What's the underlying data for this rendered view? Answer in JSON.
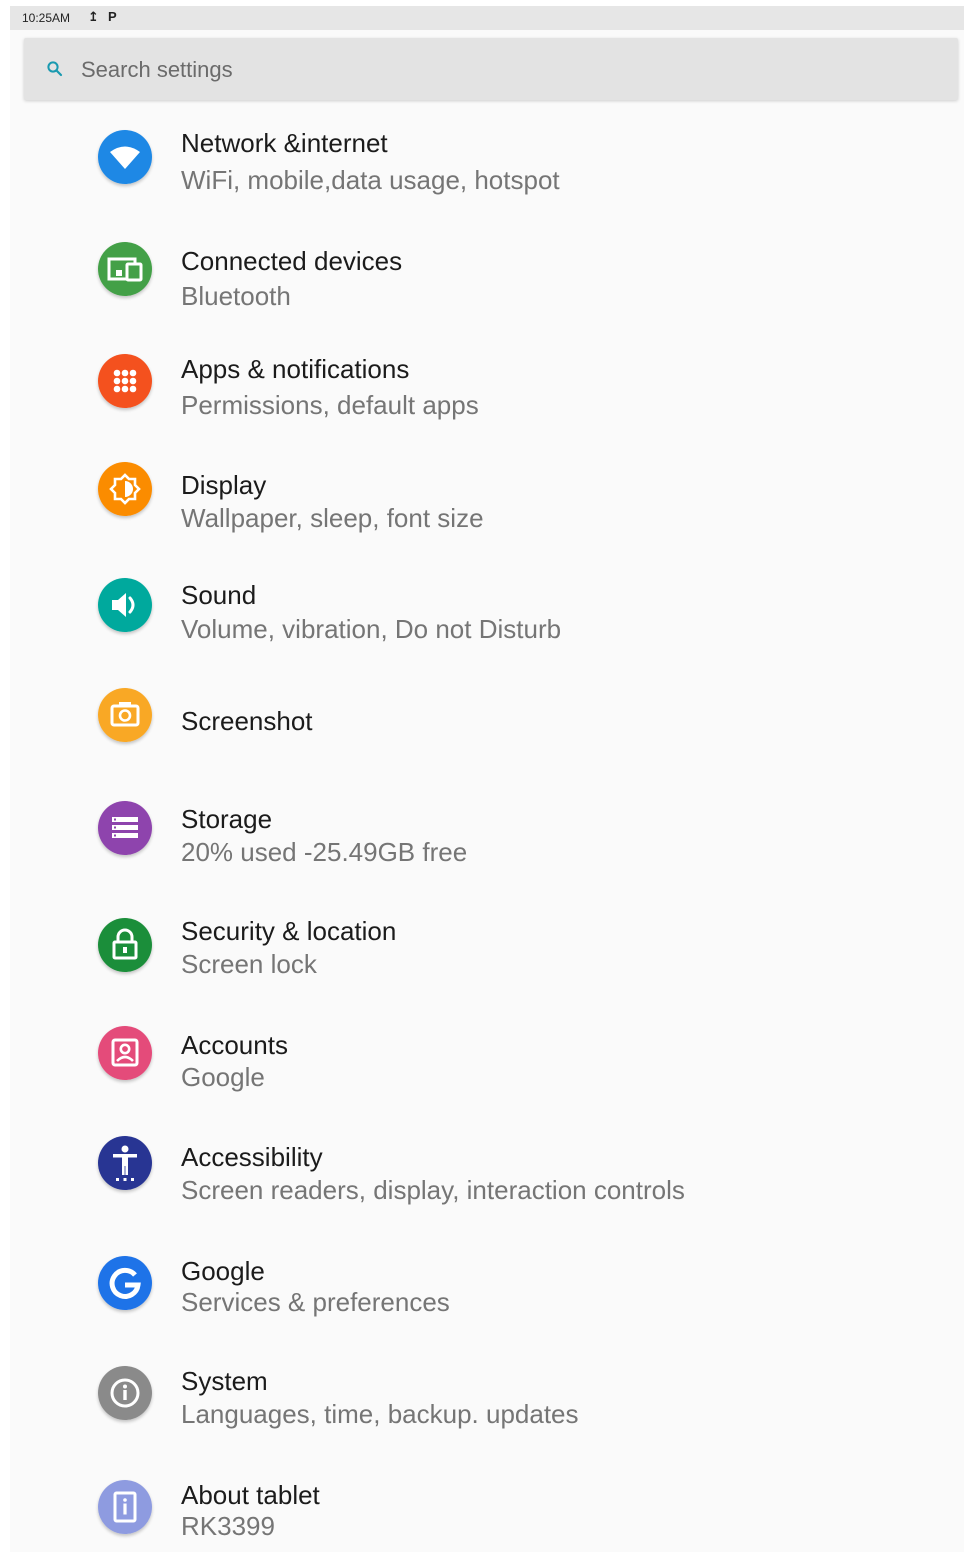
{
  "status_bar": {
    "time": "10:25AM"
  },
  "search": {
    "placeholder": "Search settings"
  },
  "items": [
    {
      "title": "Network &internet",
      "subtitle": "WiFi, mobile,data usage, hotspot",
      "icon": "wifi-icon",
      "color": "#1e88e5"
    },
    {
      "title": "Connected devices",
      "subtitle": "Bluetooth",
      "icon": "devices-icon",
      "color": "#43a047"
    },
    {
      "title": "Apps & notifications",
      "subtitle": "Permissions, default apps",
      "icon": "apps-grid-icon",
      "color": "#f4511e"
    },
    {
      "title": "Display",
      "subtitle": "Wallpaper, sleep, font size",
      "icon": "brightness-icon",
      "color": "#fb8c00"
    },
    {
      "title": "Sound",
      "subtitle": "Volume, vibration, Do not Disturb",
      "icon": "volume-icon",
      "color": "#00a99d"
    },
    {
      "title": "Screenshot",
      "subtitle": "",
      "icon": "camera-icon",
      "color": "#f9a825"
    },
    {
      "title": "Storage",
      "subtitle": "20% used -25.49GB free",
      "icon": "storage-icon",
      "color": "#8e44ad"
    },
    {
      "title": "Security & location",
      "subtitle": "Screen lock",
      "icon": "lock-icon",
      "color": "#1b8e3a"
    },
    {
      "title": "Accounts",
      "subtitle": "Google",
      "icon": "account-icon",
      "color": "#e44b7a"
    },
    {
      "title": "Accessibility",
      "subtitle": "Screen readers, display, interaction controls",
      "icon": "accessibility-icon",
      "color": "#283593"
    },
    {
      "title": "Google",
      "subtitle": "Services & preferences",
      "icon": "google-icon",
      "color": "#1e73e8"
    },
    {
      "title": "System",
      "subtitle": "Languages, time, backup. updates",
      "icon": "info-icon",
      "color": "#8a8a8a"
    },
    {
      "title": "About tablet",
      "subtitle": "RK3399",
      "icon": "tablet-info-icon",
      "color": "#8e9be0"
    }
  ]
}
